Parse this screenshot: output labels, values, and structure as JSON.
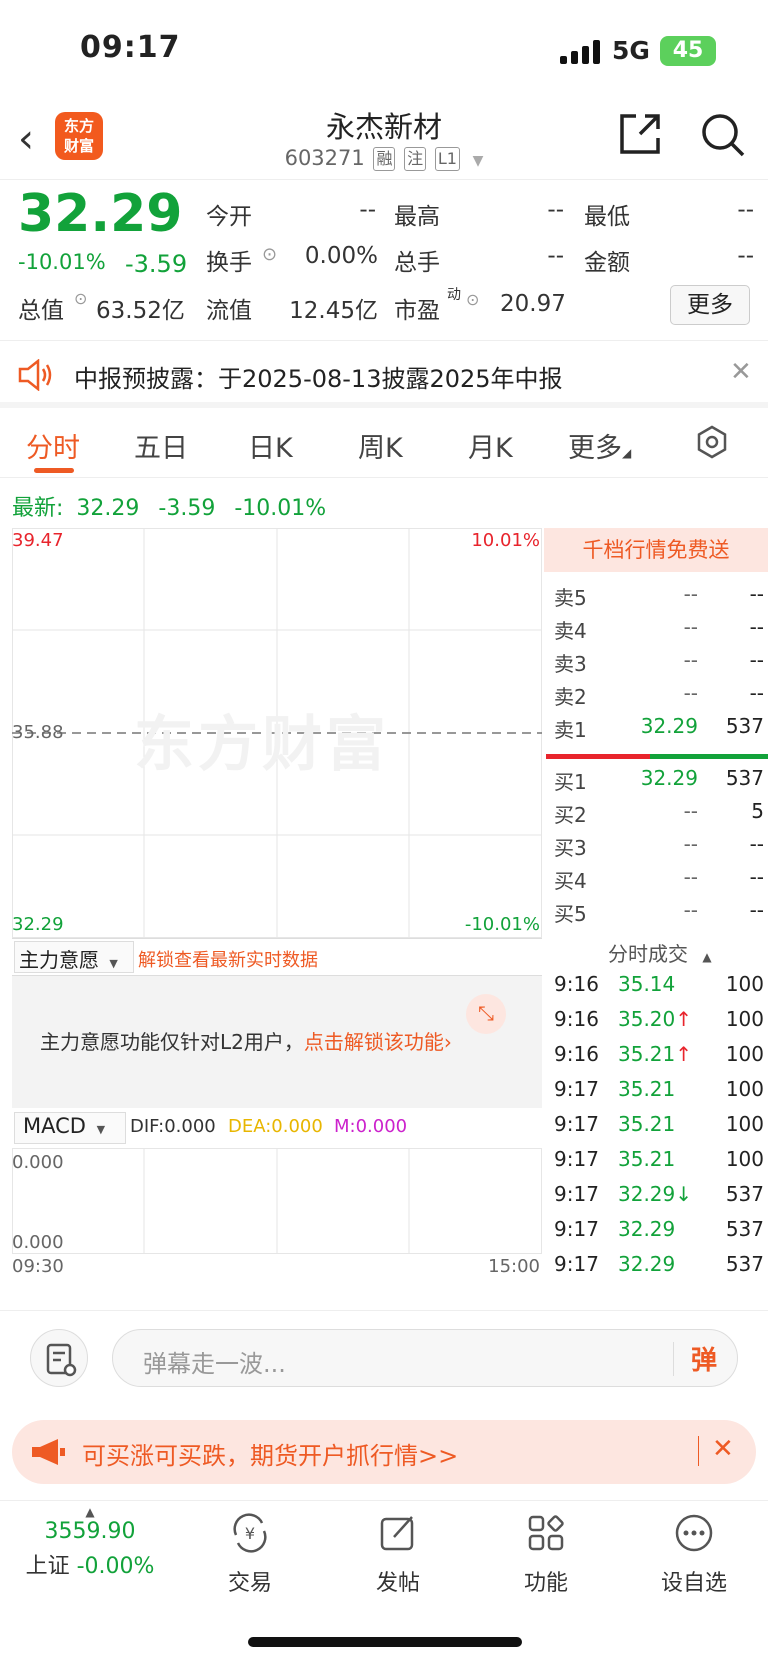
{
  "status": {
    "time": "09:17",
    "network": "5G",
    "battery": "45"
  },
  "header": {
    "logo_line1": "东方",
    "logo_line2": "财富",
    "title": "永杰新材",
    "code": "603271",
    "tags": [
      "融",
      "注",
      "L1"
    ]
  },
  "quote": {
    "price": "32.29",
    "change_pct": "-10.01%",
    "change": "-3.59",
    "fields": [
      {
        "label": "今开",
        "value": "--"
      },
      {
        "label": "最高",
        "value": "--"
      },
      {
        "label": "最低",
        "value": "--"
      },
      {
        "label": "换手",
        "value": "0.00%"
      },
      {
        "label": "总手",
        "value": "--"
      },
      {
        "label": "金额",
        "value": "--"
      },
      {
        "label": "总值",
        "value": "63.52亿"
      },
      {
        "label": "流值",
        "value": "12.45亿"
      },
      {
        "label": "市盈",
        "superscript": "动",
        "value": "20.97"
      }
    ],
    "more_label": "更多"
  },
  "notice": {
    "text": "中报预披露：于2025-08-13披露2025年中报"
  },
  "tabs": [
    "分时",
    "五日",
    "日K",
    "周K",
    "月K",
    "更多"
  ],
  "latest": {
    "label": "最新:",
    "price": "32.29",
    "change": "-3.59",
    "pct": "-10.01%"
  },
  "chart": {
    "y_top": "39.47",
    "y_mid": "35.88",
    "y_bottom": "32.29",
    "pct_top": "10.01%",
    "pct_bottom": "-10.01%",
    "watermark": "东方财富"
  },
  "main_wish": {
    "selector": "主力意愿",
    "unlock_link": "解锁查看最新实时数据",
    "box_text": "主力意愿功能仅针对L2用户，",
    "box_link": "点击解锁该功能"
  },
  "macd": {
    "selector": "MACD",
    "dif": "DIF:0.000",
    "dea": "DEA:0.000",
    "m": "M:0.000",
    "y_top": "0.000",
    "y_bottom": "0.000",
    "x_start": "09:30",
    "x_end": "15:00"
  },
  "order_book": {
    "promo": "千档行情免费送",
    "asks": [
      {
        "label": "卖5",
        "price": "--",
        "vol": "--"
      },
      {
        "label": "卖4",
        "price": "--",
        "vol": "--"
      },
      {
        "label": "卖3",
        "price": "--",
        "vol": "--"
      },
      {
        "label": "卖2",
        "price": "--",
        "vol": "--"
      },
      {
        "label": "卖1",
        "price": "32.29",
        "vol": "537"
      }
    ],
    "bids": [
      {
        "label": "买1",
        "price": "32.29",
        "vol": "537"
      },
      {
        "label": "买2",
        "price": "--",
        "vol": "5"
      },
      {
        "label": "买3",
        "price": "--",
        "vol": "--"
      },
      {
        "label": "买4",
        "price": "--",
        "vol": "--"
      },
      {
        "label": "买5",
        "price": "--",
        "vol": "--"
      }
    ]
  },
  "ticks": {
    "title": "分时成交",
    "rows": [
      {
        "time": "9:16",
        "price": "35.14",
        "arrow": "",
        "vol": "100"
      },
      {
        "time": "9:16",
        "price": "35.20",
        "arrow": "↑",
        "vol": "100"
      },
      {
        "time": "9:16",
        "price": "35.21",
        "arrow": "↑",
        "vol": "100"
      },
      {
        "time": "9:17",
        "price": "35.21",
        "arrow": "",
        "vol": "100"
      },
      {
        "time": "9:17",
        "price": "35.21",
        "arrow": "",
        "vol": "100"
      },
      {
        "time": "9:17",
        "price": "35.21",
        "arrow": "",
        "vol": "100"
      },
      {
        "time": "9:17",
        "price": "32.29",
        "arrow": "↓",
        "vol": "537"
      },
      {
        "time": "9:17",
        "price": "32.29",
        "arrow": "",
        "vol": "537"
      },
      {
        "time": "9:17",
        "price": "32.29",
        "arrow": "",
        "vol": "537"
      }
    ]
  },
  "comment": {
    "placeholder": "弹幕走一波...",
    "button": "弹"
  },
  "ad": {
    "text": "可买涨可买跌，期货开户抓行情>>"
  },
  "bottom_nav": {
    "index_value": "3559.90",
    "index_name": "上证",
    "index_change": "-0.00%",
    "items": [
      "交易",
      "发帖",
      "功能",
      "设自选"
    ]
  },
  "colors": {
    "down": "#12a23a",
    "up": "#e8242c",
    "accent": "#ee5a24"
  }
}
